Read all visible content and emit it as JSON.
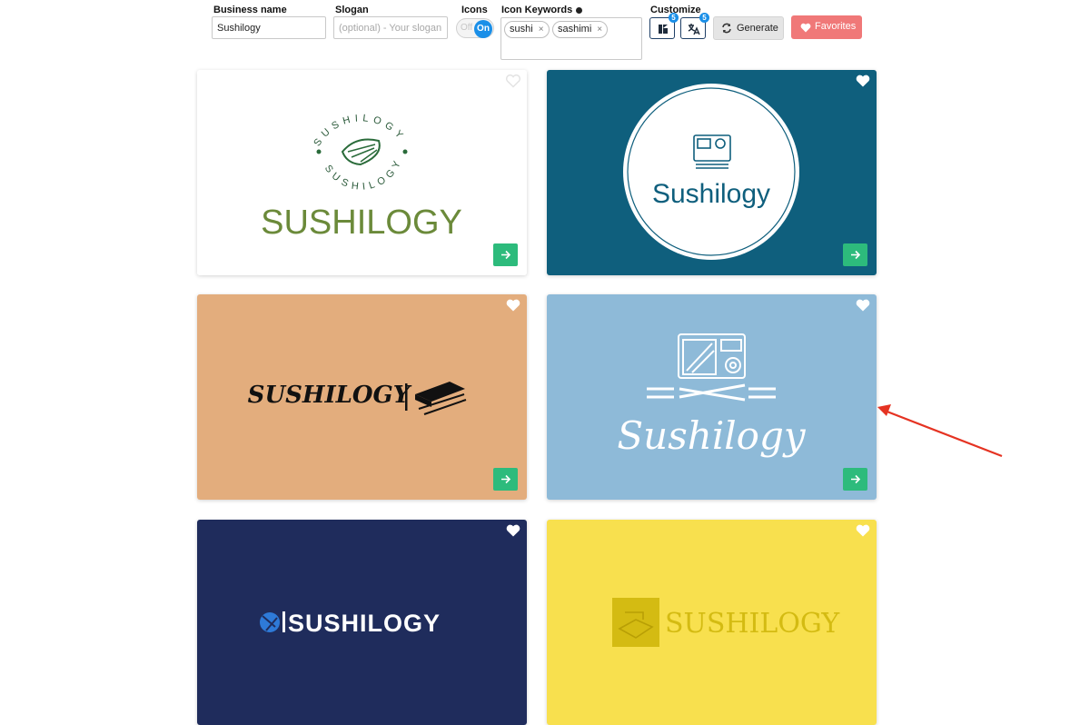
{
  "toolbar": {
    "business_name_label": "Business name",
    "business_name_value": "Sushilogy",
    "slogan_label": "Slogan",
    "slogan_placeholder": "(optional) - Your slogan",
    "icons_label": "Icons",
    "icons_toggle_off": "Off",
    "icons_toggle_on": "On",
    "icon_keywords_label": "Icon Keywords",
    "keywords": [
      {
        "label": "sushi",
        "remove": "×"
      },
      {
        "label": "sashimi",
        "remove": "×"
      }
    ],
    "customize_label": "Customize",
    "customize_badge_1": "5",
    "customize_badge_2": "5",
    "generate_label": "Generate",
    "favorites_label": "Favorites"
  },
  "cards": [
    {
      "bg": "#ffffff",
      "text": "SUSHILOGY",
      "ring_text": "SUSHILOGY",
      "action_icon": "arrow-right-icon"
    },
    {
      "bg": "#0f5f7d",
      "text": "Sushilogy",
      "action_icon": "arrow-right-icon"
    },
    {
      "bg": "#e3ad7d",
      "text": "SUSHILOGY",
      "action_icon": "arrow-right-icon"
    },
    {
      "bg": "#8ebad8",
      "text": "Sushilogy",
      "action_icon": "arrow-right-icon"
    },
    {
      "bg": "#1f2c5c",
      "text": "SUSHILOGY"
    },
    {
      "bg": "#f8e04e",
      "text": "SUSHILOGY"
    }
  ],
  "colors": {
    "accent": "#1a8fe8",
    "favorites": "#f07878",
    "go_button": "#2dbb7c",
    "annotation_arrow": "#e53322"
  }
}
